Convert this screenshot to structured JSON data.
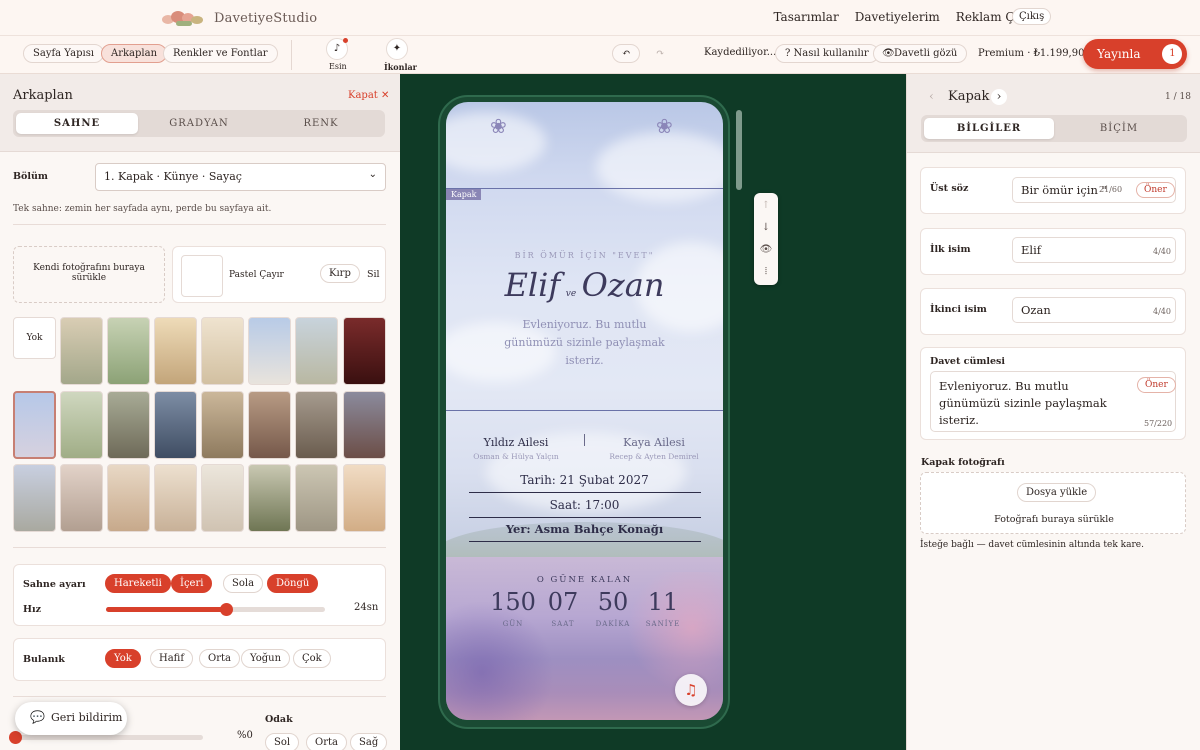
{
  "brand": {
    "name": "DavetiyeStudio"
  },
  "nav": {
    "items": [
      "Tasarımlar",
      "Davetiyelerim",
      "Reklam Çekimi"
    ],
    "logout": "Çıkış"
  },
  "toolbar": {
    "tabs": [
      "Sayfa Yapısı",
      "Arkaplan",
      "Renkler ve Fontlar"
    ],
    "active_tab": "Arkaplan",
    "music_label": "Esin",
    "icons_label": "İkonlar",
    "undo": "↶",
    "redo": "↷",
    "saving": "Kaydediliyor...",
    "help": "? Nasıl kullanılır",
    "guest_view": "Davetli gözü",
    "premium": "Premium · ₺1.199,90",
    "publish": "Yayınla",
    "publish_count": "1"
  },
  "left": {
    "title": "Arkaplan",
    "close": "Kapat ✕",
    "segments": [
      "SAHNE",
      "GRADYAN",
      "RENK"
    ],
    "active_segment": "SAHNE",
    "section_label": "Bölüm",
    "section_value": "1. Kapak · Künye · Sayaç",
    "hint": "Tek sahne: zemin her sayfada aynı, perde bu sayfaya ait.",
    "drop_text": "Kendi fotoğrafını buraya sürükle",
    "preset_name": "Pastel Çayır",
    "crop": "Kırp",
    "delete": "Sil",
    "none_thumb": "Yok",
    "scene_label": "Sahne ayarı",
    "scene_opts": [
      "Hareketli",
      "İçeri",
      "Sola",
      "Döngü"
    ],
    "scene_on": [
      "Hareketli",
      "İçeri",
      "Döngü"
    ],
    "speed_label": "Hız",
    "speed_value": "24sn",
    "speed_level": 0.55,
    "blur_label": "Bulanık",
    "blur_opts": [
      "Yok",
      "Hafif",
      "Orta",
      "Yoğun",
      "Çok"
    ],
    "blur_on": "Yok",
    "percent": "%0",
    "focus_label": "Odak",
    "focus_opts": [
      "Sol",
      "Orta",
      "Sağ"
    ],
    "feedback": "Geri bildirim"
  },
  "preview": {
    "tag": "Kapak",
    "eyebrow": "BİR ÖMÜR İÇİN \"EVET\"",
    "name1": "Elif",
    "amp": "ve",
    "name2": "Ozan",
    "message": "Evleniyoruz. Bu mutlu günümüzü sizinle paylaşmak isteriz.",
    "family1": "Yıldız Ailesi",
    "family1_sub": "Osman & Hülya Yalçın",
    "family2": "Kaya Ailesi",
    "family2_sub": "Recep & Ayten Demirel",
    "date_label": "Tarih:",
    "date": "21 Şubat 2027",
    "time_label": "Saat:",
    "time": "17:00",
    "place_label": "Yer:",
    "place": "Asma Bahçe Konağı",
    "countdown_title": "O GÜNE KALAN",
    "countdown": [
      {
        "v": "150",
        "l": "GÜN"
      },
      {
        "v": "07",
        "l": "SAAT"
      },
      {
        "v": "50",
        "l": "DAKİKA"
      },
      {
        "v": "11",
        "l": "SANİYE"
      }
    ]
  },
  "right": {
    "title": "Kapak",
    "page": "1 / 18",
    "segments": [
      "BİLGİLER",
      "BİÇİM"
    ],
    "active_segment": "BİLGİLER",
    "fields": [
      {
        "label": "Üst söz",
        "value": "Bir ömür için \"",
        "count": "21/60",
        "suggest": "Öner"
      },
      {
        "label": "İlk isim",
        "value": "Elif",
        "count": "4/40"
      },
      {
        "label": "İkinci isim",
        "value": "Ozan",
        "count": "4/40"
      }
    ],
    "invite_label": "Davet cümlesi",
    "invite_value": "Evleniyoruz. Bu mutlu günümüzü sizinle paylaşmak isteriz.",
    "invite_count": "57/220",
    "invite_suggest": "Öner",
    "photo_label": "Kapak fotoğrafı",
    "upload": "Dosya yükle",
    "drop": "Fotoğrafı buraya sürükle",
    "photo_hint": "İsteğe bağlı — davet cümlesinin altında tek kare."
  }
}
